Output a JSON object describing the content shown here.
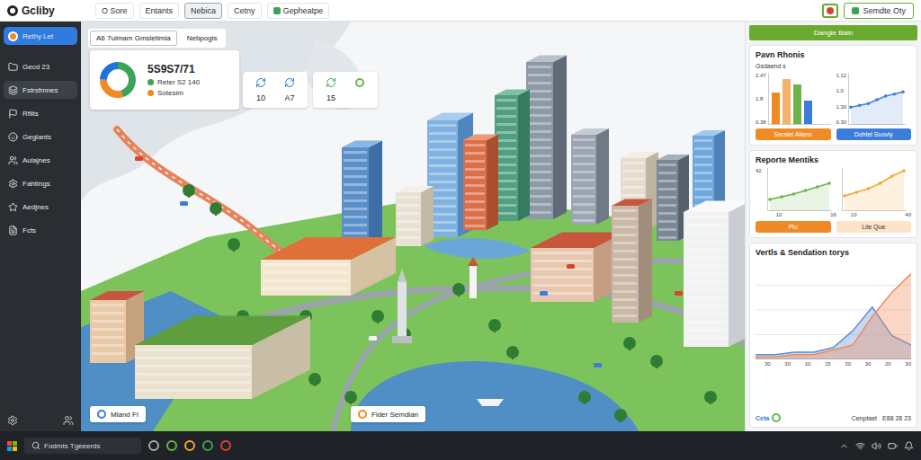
{
  "app": {
    "logo": "Gcliby"
  },
  "toolbar": {
    "tabs": [
      {
        "label": "O Sore",
        "selected": false
      },
      {
        "label": "Entants",
        "selected": false
      },
      {
        "label": "Nebica",
        "selected": true
      },
      {
        "label": "Cetny",
        "selected": false
      },
      {
        "label": "Gepheatpe",
        "selected": false
      }
    ],
    "action": "Semdte Oty"
  },
  "sidebar": {
    "items": [
      {
        "label": "Rethy Let",
        "selected": true,
        "highlighted": false
      },
      {
        "label": "Gecd 23",
        "selected": false,
        "highlighted": false
      },
      {
        "label": "Fstrsfmnes",
        "selected": false,
        "highlighted": true
      },
      {
        "label": "Rflits",
        "selected": false,
        "highlighted": false
      },
      {
        "label": "Geglants",
        "selected": false,
        "highlighted": false
      },
      {
        "label": "Aulajnes",
        "selected": false,
        "highlighted": false
      },
      {
        "label": "Fahtings",
        "selected": false,
        "highlighted": false
      },
      {
        "label": "Aedjnes",
        "selected": false,
        "highlighted": false
      },
      {
        "label": "Fcts",
        "selected": false,
        "highlighted": false
      }
    ]
  },
  "map": {
    "tabs": [
      {
        "label": "A6 7ulmam Gmsletimia",
        "selected": true
      },
      {
        "label": "Nebpogis",
        "selected": false
      }
    ],
    "summary": {
      "value": "5S9S7/71",
      "legend": [
        {
          "label": "Reter S2 140",
          "color": "#3aa655"
        },
        {
          "label": "Sotesim",
          "color": "#f08a24"
        }
      ],
      "donut": [
        {
          "value": 45,
          "color": "#3aa655"
        },
        {
          "value": 30,
          "color": "#f08a24"
        },
        {
          "value": 25,
          "color": "#1e73d8"
        }
      ]
    },
    "stat_cards": [
      {
        "items": [
          {
            "value": "10"
          },
          {
            "value": "A7"
          }
        ]
      },
      {
        "items": [
          {
            "value": "15"
          }
        ]
      }
    ],
    "labels": [
      {
        "text": "Mland Fl",
        "color": "#3b7dd8"
      },
      {
        "text": "Fider Semdlan",
        "color": "#f08a24"
      }
    ]
  },
  "panel": {
    "header": "Dangle Bain",
    "performance": {
      "title": "Pavn Rhonis",
      "subtitle": "Gsdaend s",
      "bar_chart": {
        "ticks": [
          "2.47",
          "1.8",
          "0.38"
        ],
        "max": 2.6,
        "bars": [
          {
            "value": 1.6,
            "color": "#f08a24"
          },
          {
            "value": 2.3,
            "color": "#f5b26b"
          },
          {
            "value": 2.0,
            "color": "#6bb34a"
          },
          {
            "value": 1.2,
            "color": "#3b7dd8"
          }
        ]
      },
      "line_chart": {
        "ticks": [
          "1.12",
          "1.0",
          "1.30",
          "0.30"
        ],
        "min": 0.3,
        "max": 1.3,
        "values": [
          0.62,
          0.66,
          0.7,
          0.78,
          0.86,
          0.9,
          0.95
        ],
        "color": "#3b7dd8"
      },
      "buttons": [
        {
          "label": "Sersiel Aliens",
          "color": "#f08a24"
        },
        {
          "label": "Dohtel Suoviy",
          "color": "#3b7dd8"
        }
      ]
    },
    "metrics": {
      "title": "Reporte Mentiks",
      "tick": "42",
      "left": {
        "values": [
          10,
          13,
          16,
          20,
          24,
          28
        ],
        "min": 0,
        "max": 42,
        "color": "#6bb34a",
        "x_ticks": [
          "10",
          "16"
        ]
      },
      "right": {
        "values": [
          14,
          18,
          22,
          28,
          36,
          42
        ],
        "min": 0,
        "max": 42,
        "color": "#f0a830",
        "x_ticks": [
          "10",
          "40"
        ]
      },
      "buttons": [
        {
          "label": "Plu",
          "color": "#f08a24"
        },
        {
          "label": "Lile Que",
          "color": "#fde3c8"
        }
      ]
    },
    "trends": {
      "title": "Vertls & Sendation torys",
      "max": 40,
      "x_ticks": [
        "30",
        "30",
        "10",
        "15",
        "30",
        "30",
        "20",
        "30"
      ],
      "series": [
        {
          "values": [
            2,
            2,
            3,
            3,
            5,
            12,
            22,
            10,
            6
          ],
          "color": "#5b8fd6"
        },
        {
          "values": [
            1,
            1,
            2,
            2,
            4,
            6,
            18,
            28,
            36
          ],
          "color": "#f08a5d"
        }
      ],
      "footer": {
        "label": "Ceta",
        "status": "Cenptaet",
        "value": "E88 28 23"
      }
    }
  },
  "taskbar": {
    "search": "Fodmts Tgeeerds"
  }
}
